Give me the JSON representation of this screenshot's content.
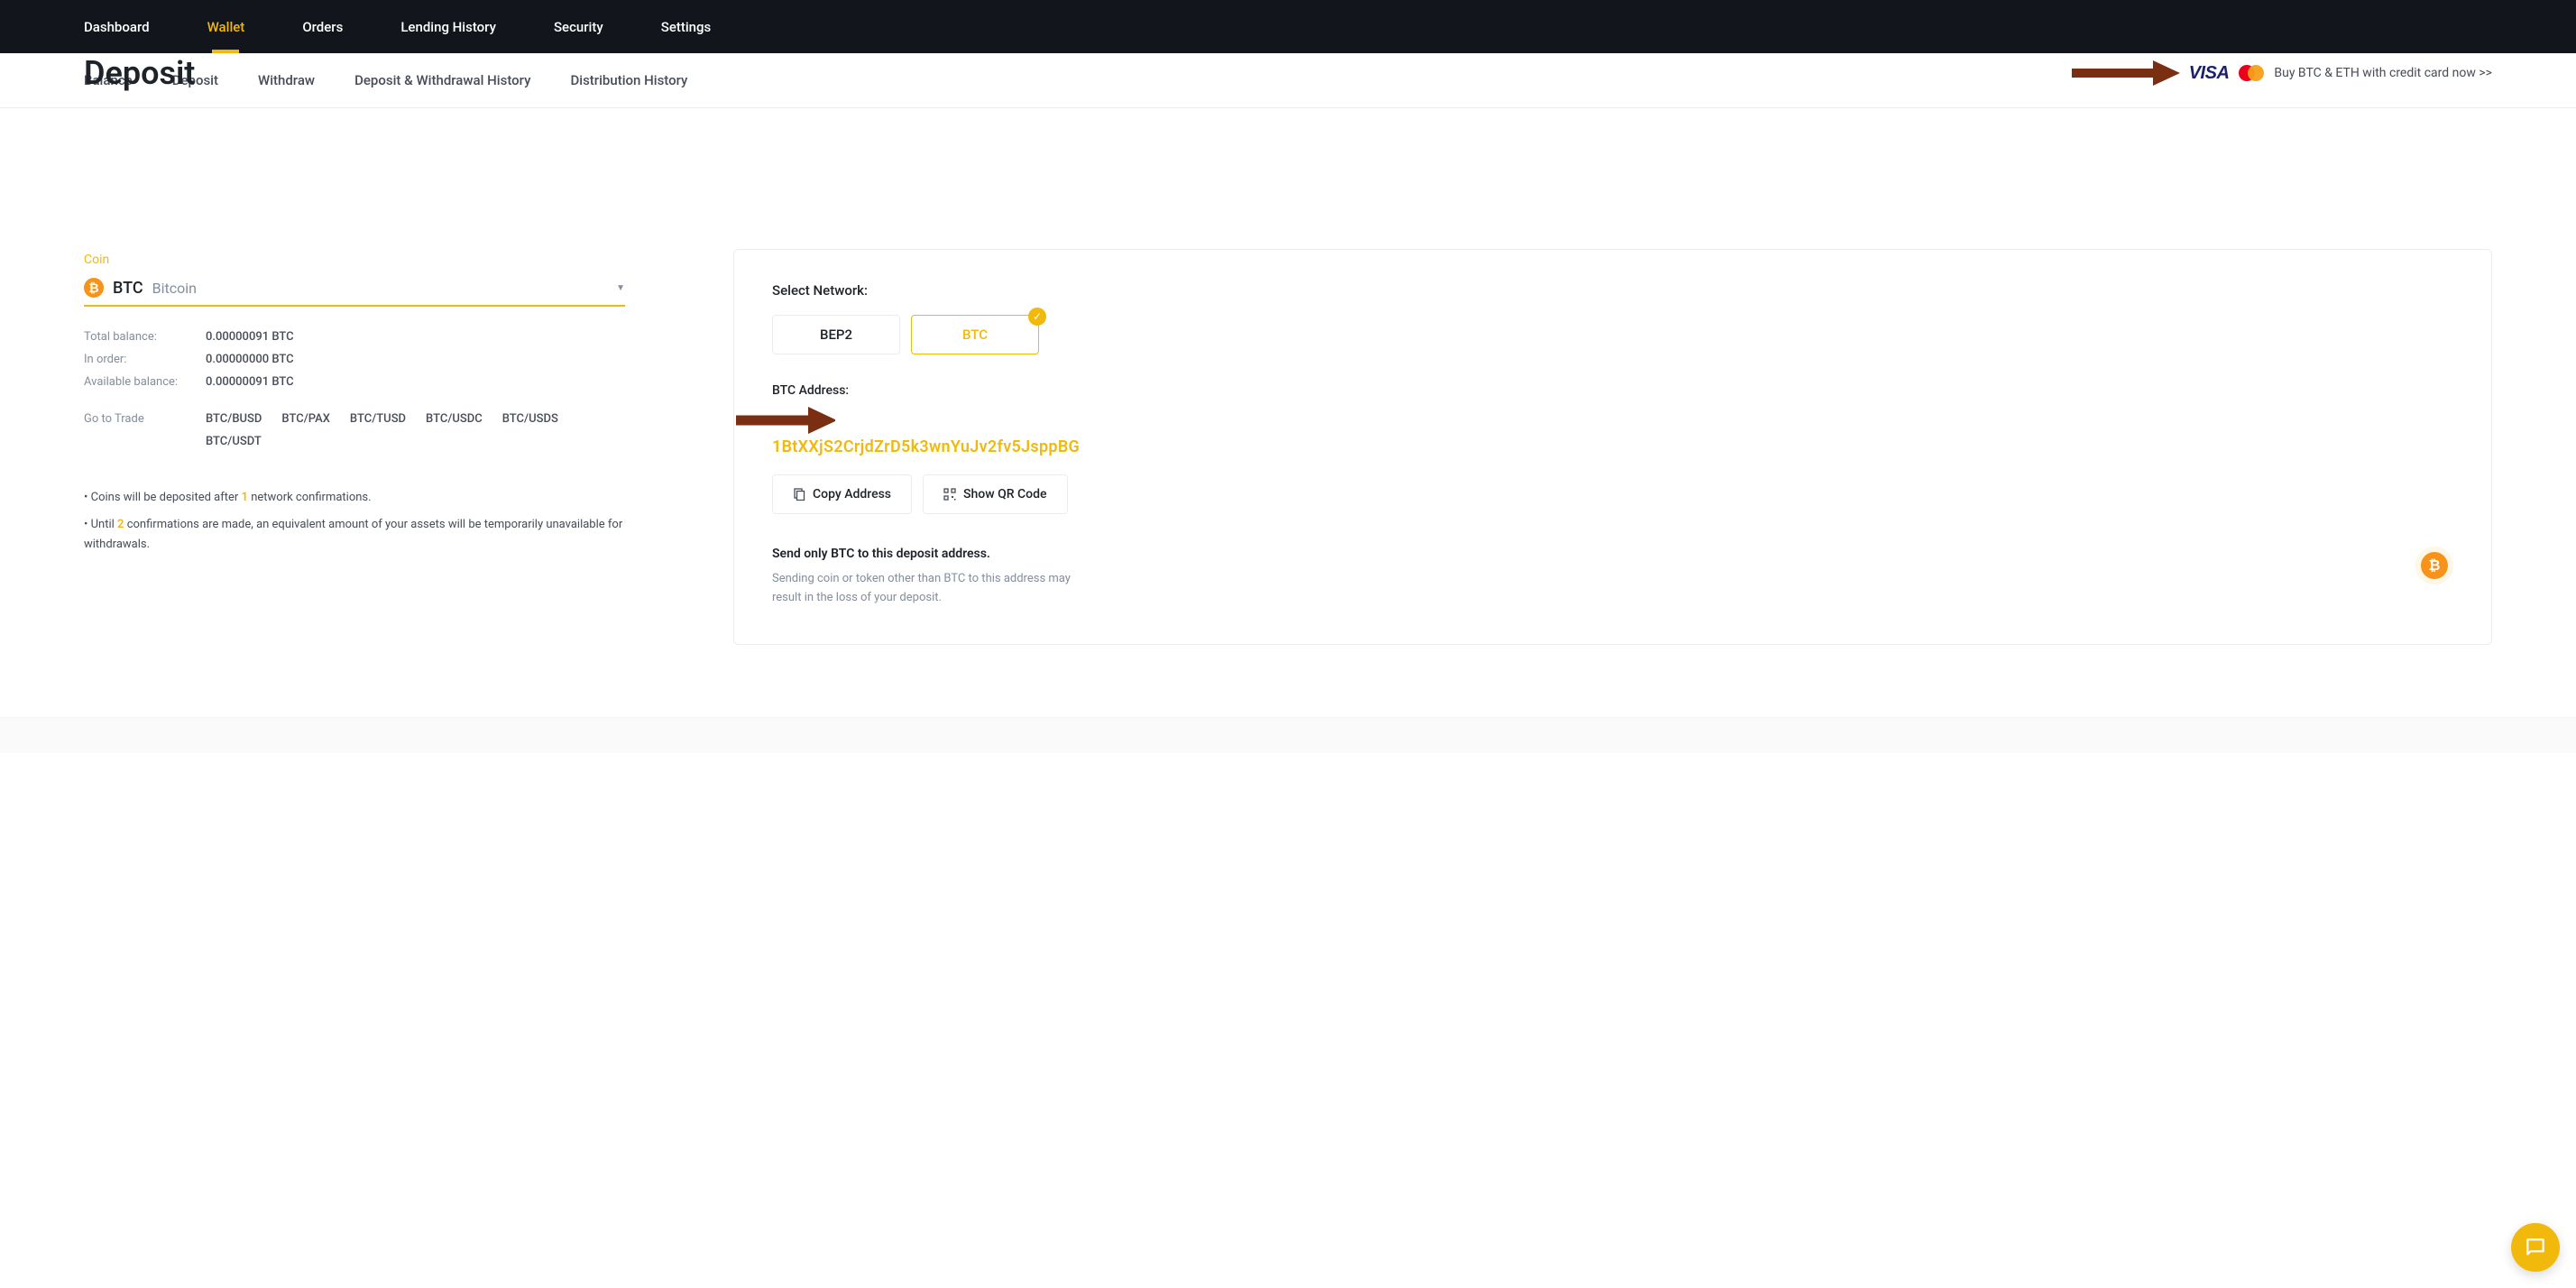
{
  "topnav": {
    "items": [
      {
        "label": "Dashboard",
        "active": false
      },
      {
        "label": "Wallet",
        "active": true
      },
      {
        "label": "Orders",
        "active": false
      },
      {
        "label": "Lending History",
        "active": false
      },
      {
        "label": "Security",
        "active": false
      },
      {
        "label": "Settings",
        "active": false
      }
    ]
  },
  "subnav": {
    "items": [
      {
        "label": "Balance"
      },
      {
        "label": "Deposit"
      },
      {
        "label": "Withdraw"
      },
      {
        "label": "Deposit & Withdrawal History"
      },
      {
        "label": "Distribution History"
      }
    ]
  },
  "page": {
    "title": "Deposit",
    "cc_link": "Buy BTC & ETH with credit card now >>",
    "visa_text": "VISA"
  },
  "coin": {
    "label": "Coin",
    "symbol": "BTC",
    "name": "Bitcoin",
    "icon_glyph": "₿"
  },
  "balances": {
    "total_label": "Total balance:",
    "total_value": "0.00000091 BTC",
    "inorder_label": "In order:",
    "inorder_value": "0.00000000 BTC",
    "avail_label": "Available balance:",
    "avail_value": "0.00000091 BTC"
  },
  "trade": {
    "label": "Go to Trade",
    "pairs": [
      "BTC/BUSD",
      "BTC/PAX",
      "BTC/TUSD",
      "BTC/USDC",
      "BTC/USDS",
      "BTC/USDT"
    ]
  },
  "notes": {
    "line1_prefix": "• Coins will be deposited after ",
    "line1_hl": "1",
    "line1_suffix": " network confirmations.",
    "line2_prefix": "• Until ",
    "line2_hl": "2",
    "line2_suffix": " confirmations are made, an equivalent amount of your assets will be temporarily unavailable for withdrawals."
  },
  "panel": {
    "network_label": "Select Network:",
    "networks": [
      {
        "label": "BEP2",
        "selected": false
      },
      {
        "label": "BTC",
        "selected": true
      }
    ],
    "addr_label": "BTC Address:",
    "addr_value": "1BtXXjS2CrjdZrD5k3wnYuJv2fv5JsppBG",
    "copy_label": "Copy Address",
    "qr_label": "Show QR Code",
    "warn_title": "Send only BTC to this deposit address.",
    "warn_desc": "Sending coin or token other than BTC to this address may result in the loss of your deposit.",
    "warn_glyph": "₿"
  },
  "colors": {
    "accent": "#f0b90b",
    "btc": "#f7931a",
    "arrow": "#7a2e12"
  }
}
